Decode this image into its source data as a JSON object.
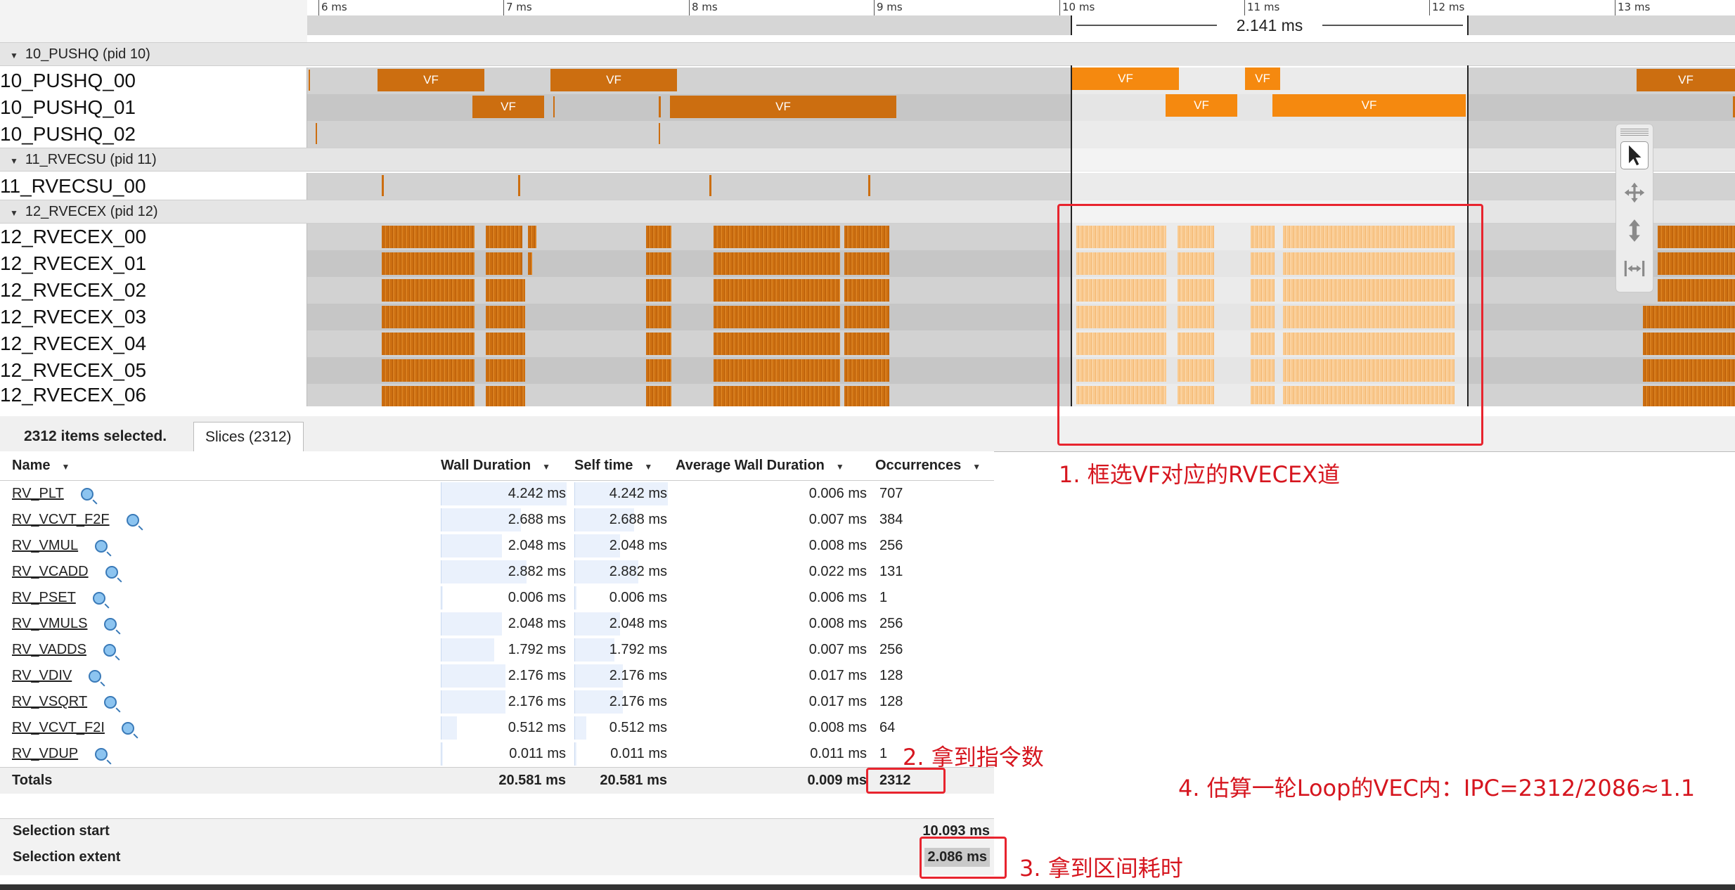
{
  "ruler": {
    "ticks": [
      "6 ms",
      "7 ms",
      "8 ms",
      "9 ms",
      "10 ms",
      "11 ms",
      "12 ms",
      "13 ms"
    ],
    "range_label": "2.141 ms"
  },
  "processes": [
    {
      "label": "10_PUSHQ (pid 10)",
      "threads": [
        "10_PUSHQ_00",
        "10_PUSHQ_01",
        "10_PUSHQ_02"
      ]
    },
    {
      "label": "11_RVECSU (pid 11)",
      "threads": [
        "11_RVECSU_00"
      ]
    },
    {
      "label": "12_RVECEX (pid 12)",
      "threads": [
        "12_RVECEX_00",
        "12_RVECEX_01",
        "12_RVECEX_02",
        "12_RVECEX_03",
        "12_RVECEX_04",
        "12_RVECEX_05",
        "12_RVECEX_06"
      ]
    }
  ],
  "slice_label": "VF",
  "tools": [
    "pointer-icon",
    "pan-icon",
    "zoom-icon",
    "fit-width-icon"
  ],
  "selection": {
    "count_text": "2312 items selected.",
    "tab_label": "Slices (2312)"
  },
  "table": {
    "headers": {
      "name": "Name",
      "wall": "Wall Duration",
      "self": "Self time",
      "avg": "Average Wall Duration",
      "occ": "Occurrences"
    },
    "rows": [
      {
        "name": "RV_PLT",
        "wall": "4.242 ms",
        "self": "4.242 ms",
        "avg": "0.006 ms",
        "occ": "707",
        "wall_frac": 1.0
      },
      {
        "name": "RV_VCVT_F2F",
        "wall": "2.688 ms",
        "self": "2.688 ms",
        "avg": "0.007 ms",
        "occ": "384",
        "wall_frac": 0.634
      },
      {
        "name": "RV_VMUL",
        "wall": "2.048 ms",
        "self": "2.048 ms",
        "avg": "0.008 ms",
        "occ": "256",
        "wall_frac": 0.483
      },
      {
        "name": "RV_VCADD",
        "wall": "2.882 ms",
        "self": "2.882 ms",
        "avg": "0.022 ms",
        "occ": "131",
        "wall_frac": 0.679
      },
      {
        "name": "RV_PSET",
        "wall": "0.006 ms",
        "self": "0.006 ms",
        "avg": "0.006 ms",
        "occ": "1",
        "wall_frac": 0.001
      },
      {
        "name": "RV_VMULS",
        "wall": "2.048 ms",
        "self": "2.048 ms",
        "avg": "0.008 ms",
        "occ": "256",
        "wall_frac": 0.483
      },
      {
        "name": "RV_VADDS",
        "wall": "1.792 ms",
        "self": "1.792 ms",
        "avg": "0.007 ms",
        "occ": "256",
        "wall_frac": 0.422
      },
      {
        "name": "RV_VDIV",
        "wall": "2.176 ms",
        "self": "2.176 ms",
        "avg": "0.017 ms",
        "occ": "128",
        "wall_frac": 0.513
      },
      {
        "name": "RV_VSQRT",
        "wall": "2.176 ms",
        "self": "2.176 ms",
        "avg": "0.017 ms",
        "occ": "128",
        "wall_frac": 0.513
      },
      {
        "name": "RV_VCVT_F2I",
        "wall": "0.512 ms",
        "self": "0.512 ms",
        "avg": "0.008 ms",
        "occ": "64",
        "wall_frac": 0.121
      },
      {
        "name": "RV_VDUP",
        "wall": "0.011 ms",
        "self": "0.011 ms",
        "avg": "0.011 ms",
        "occ": "1",
        "wall_frac": 0.003
      }
    ],
    "totals": {
      "label": "Totals",
      "wall": "20.581 ms",
      "self": "20.581 ms",
      "avg": "0.009 ms",
      "occ": "2312"
    }
  },
  "summary": {
    "start_label": "Selection start",
    "start_value": "10.093 ms",
    "extent_label": "Selection extent",
    "extent_value": "2.086 ms"
  },
  "annotations": {
    "step1": "1. 框选VF对应的RVECEX道",
    "step2": "2. 拿到指令数",
    "step3": "3. 拿到区间耗时",
    "step4": "4. 估算一轮Loop的VEC内：IPC=2312/2086≈1.1"
  },
  "colors": {
    "slice": "#cc6e10",
    "slice_selected": "#f5890f",
    "annotation": "#e8242e"
  }
}
